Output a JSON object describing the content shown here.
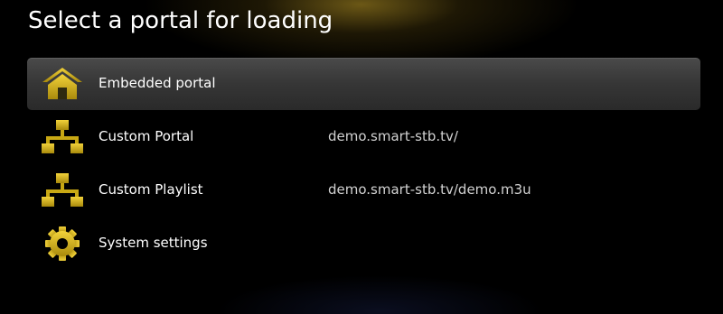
{
  "header": {
    "title": "Select a portal for loading"
  },
  "colors": {
    "accent": "#c8a814",
    "selected_row": "#3c3c3c",
    "background": "#000000"
  },
  "menu": {
    "items": [
      {
        "label": "Embedded portal",
        "value": "",
        "icon": "home-icon",
        "selected": true
      },
      {
        "label": "Custom Portal",
        "value": "demo.smart-stb.tv/",
        "icon": "network-icon",
        "selected": false
      },
      {
        "label": "Custom Playlist",
        "value": "demo.smart-stb.tv/demo.m3u",
        "icon": "network-icon",
        "selected": false
      },
      {
        "label": "System settings",
        "value": "",
        "icon": "gear-icon",
        "selected": false
      }
    ]
  }
}
